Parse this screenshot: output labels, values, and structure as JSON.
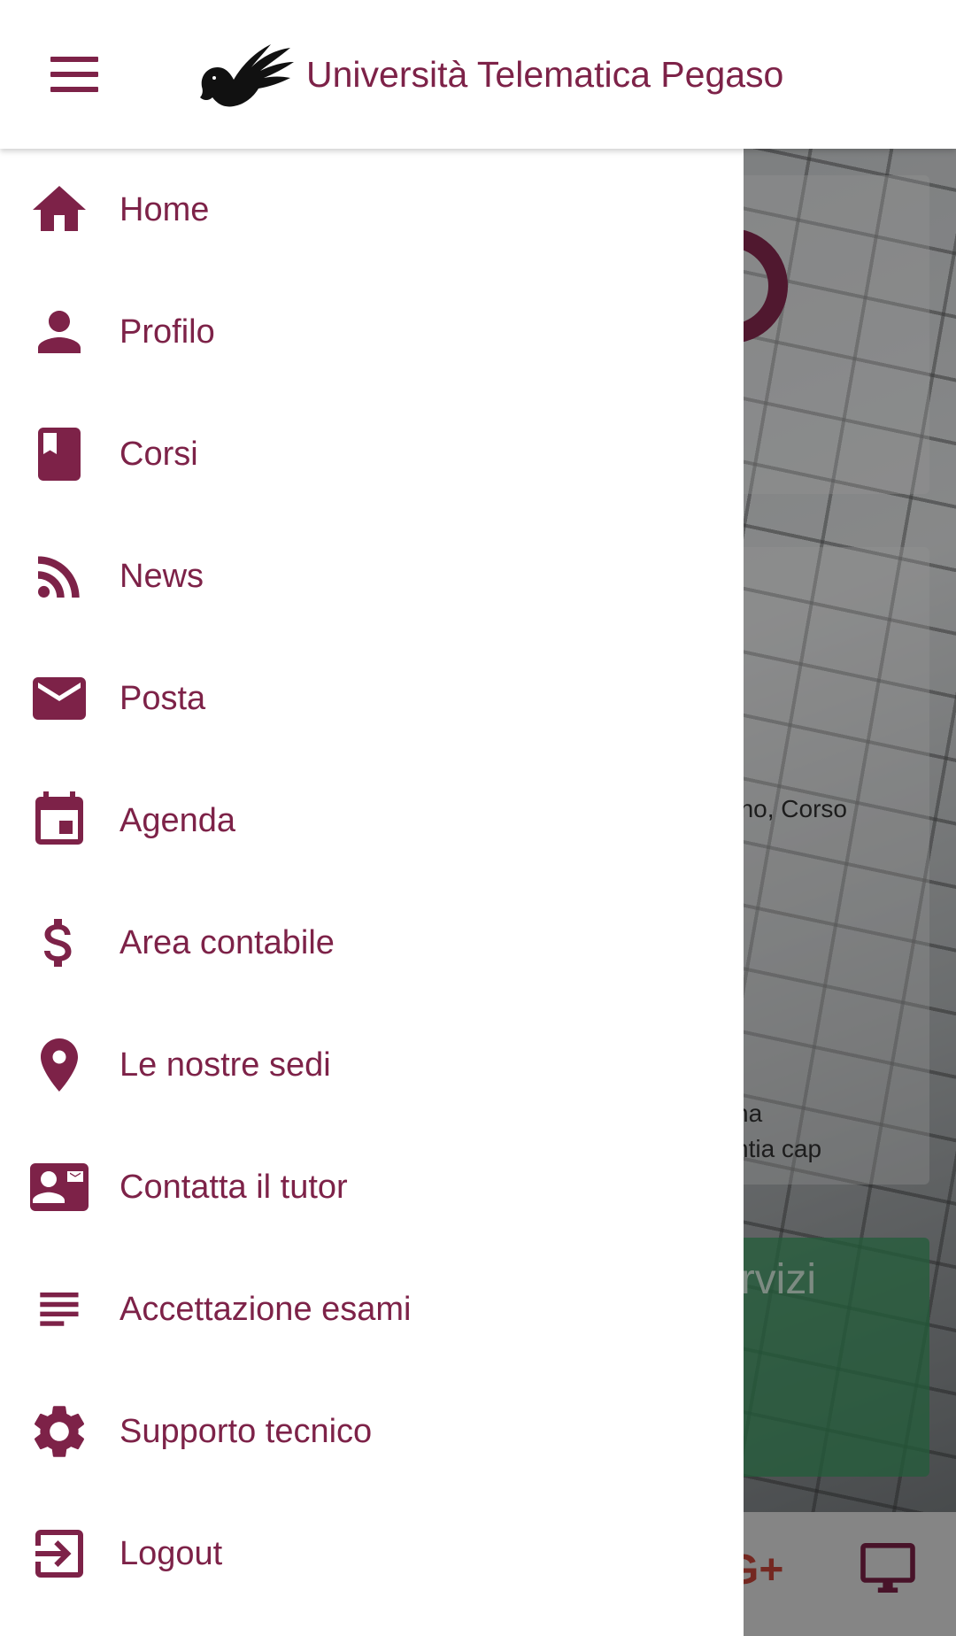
{
  "app_bar": {
    "title": "Università Telematica Pegaso",
    "menu_icon": "hamburger-menu-icon",
    "logo_icon": "pegasus-logo"
  },
  "background_page": {
    "text_fragment_1": "ano, Corso",
    "text_fragment_2": "na",
    "text_fragment_3": "ntia cap",
    "servizi_fragment": "ervizi",
    "social_fragment": "G+"
  },
  "drawer": {
    "items": [
      {
        "label": "Home",
        "icon": "home-icon"
      },
      {
        "label": "Profilo",
        "icon": "person-icon"
      },
      {
        "label": "Corsi",
        "icon": "book-icon"
      },
      {
        "label": "News",
        "icon": "rss-feed-icon"
      },
      {
        "label": "Posta",
        "icon": "mail-icon"
      },
      {
        "label": "Agenda",
        "icon": "calendar-icon"
      },
      {
        "label": "Area contabile",
        "icon": "dollar-icon"
      },
      {
        "label": "Le nostre sedi",
        "icon": "location-pin-icon"
      },
      {
        "label": "Contatta il tutor",
        "icon": "contact-card-icon"
      },
      {
        "label": "Accettazione esami",
        "icon": "text-lines-icon"
      },
      {
        "label": "Supporto tecnico",
        "icon": "gear-icon"
      },
      {
        "label": "Logout",
        "icon": "logout-icon"
      }
    ]
  },
  "colors": {
    "brand": "#7d2248",
    "drawer_bg": "#ffffff",
    "scrim": "rgba(0,0,0,0.42)"
  }
}
